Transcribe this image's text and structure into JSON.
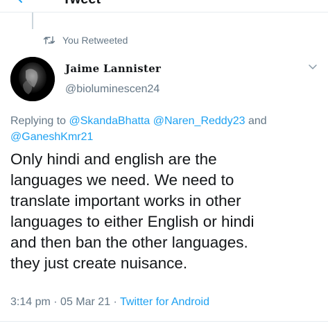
{
  "header": {
    "title": "Tweet"
  },
  "retweet": {
    "label": "You Retweeted",
    "icon": "retweet-icon"
  },
  "tweet": {
    "display_name": "Jaime Lannister",
    "handle": "@bioluminescen24",
    "replying_prefix": "Replying to",
    "mentions": [
      "@SkandaBhatta",
      "@Naren_Reddy23"
    ],
    "replying_and": "and",
    "mention_last": "@GaneshKmr21",
    "text_lines": [
      "Only hindi and english are the",
      "languages we need. We need to",
      "translate important works in other",
      "languages to either English or hindi",
      "and then ban the other languages.",
      "they just create nuisance."
    ],
    "time": "3:14 pm",
    "separator": "·",
    "date": "05 Mar 21",
    "source": "Twitter for Android"
  },
  "colors": {
    "accent": "#1da1f2",
    "secondary_text": "#657786",
    "primary_text": "#14171a"
  }
}
